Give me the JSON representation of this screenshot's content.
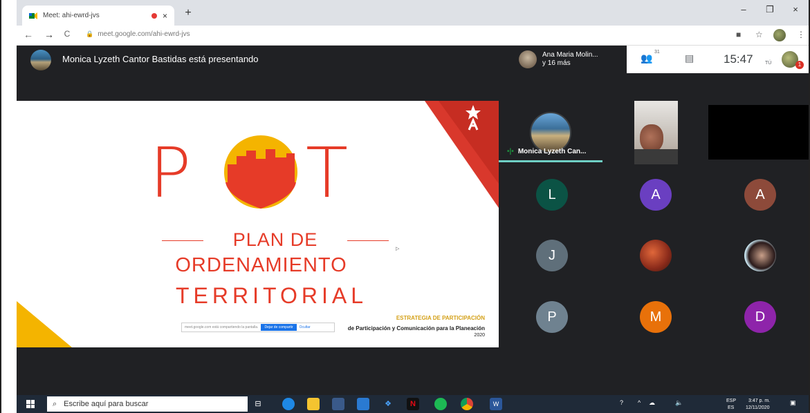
{
  "browser": {
    "tab_title": "Meet: ahi-ewrd-jvs",
    "tab_close": "×",
    "new_tab": "+",
    "minimize": "–",
    "restore": "❐",
    "close": "×",
    "back": "←",
    "forward": "→",
    "reload": "C",
    "url": "meet.google.com/ahi-ewrd-jvs",
    "star": "☆",
    "menu": "⋮"
  },
  "meet": {
    "presenting_text": "Monica Lyzeth Cantor Bastidas está presentando",
    "people_chip_name": "Ana Maria Molin...",
    "people_chip_more": "y 16 más",
    "participant_count": "31",
    "clock": "15:47",
    "self_label": "TÚ",
    "notification_count": "1"
  },
  "slide": {
    "pot_left": "P",
    "pot_right": "T",
    "line1": "PLAN DE",
    "line2": "ORDENAMIENTO",
    "line3": "TERRITORIAL",
    "strategy": "ESTRATEGIA DE PARTICIPACIÓN",
    "subtitle": "de Participación y Comunicación para la Planeación",
    "year": "2020",
    "share_text": "meet.google.com está compartiendo la pantalla.",
    "share_stop": "Dejar de compartir",
    "share_hide": "Ocultar",
    "cursor": "▷"
  },
  "participants": {
    "presenter_name": "Monica Lyzeth Can...",
    "bubbles": [
      {
        "letter": "L",
        "color": "#0b5345"
      },
      {
        "letter": "A",
        "color": "#6a3fc1"
      },
      {
        "letter": "A",
        "color": "#8d4a3a"
      },
      {
        "letter": "J",
        "color": "#5f6f7a"
      },
      {
        "letter": "P",
        "color": "#6f8290"
      },
      {
        "letter": "M",
        "color": "#e8710a"
      },
      {
        "letter": "D",
        "color": "#8e24aa"
      }
    ]
  },
  "taskbar": {
    "search_placeholder": "Escribe aquí para buscar",
    "lang_top": "ESP",
    "lang_bottom": "ES",
    "time": "3:47 p. m.",
    "date": "12/11/2020"
  },
  "colors": {
    "meet_bg": "#202124",
    "slide_red": "#e63b28",
    "slide_yellow": "#f4b400",
    "taskbar": "#1f2a38"
  }
}
